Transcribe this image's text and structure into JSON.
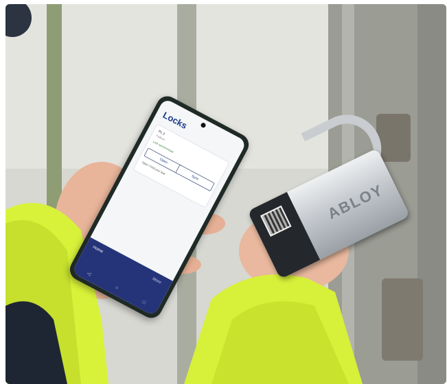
{
  "phone_app": {
    "title": "Locks",
    "lock_name": "PL 2",
    "lock_subtitle": "Padlock",
    "lock_status": "Lock synchronised",
    "open_label": "Open",
    "sync_label": "Sync",
    "find_text": "Open / Find your lock",
    "nav_home": "Home",
    "nav_more": "More",
    "system_nav": [
      "◁",
      "○",
      "□"
    ]
  },
  "padlock": {
    "brand": "ABLOY"
  },
  "colors": {
    "app_header": "#1c3a8a",
    "app_nav": "#253479",
    "jacket": "#d8f23a"
  }
}
